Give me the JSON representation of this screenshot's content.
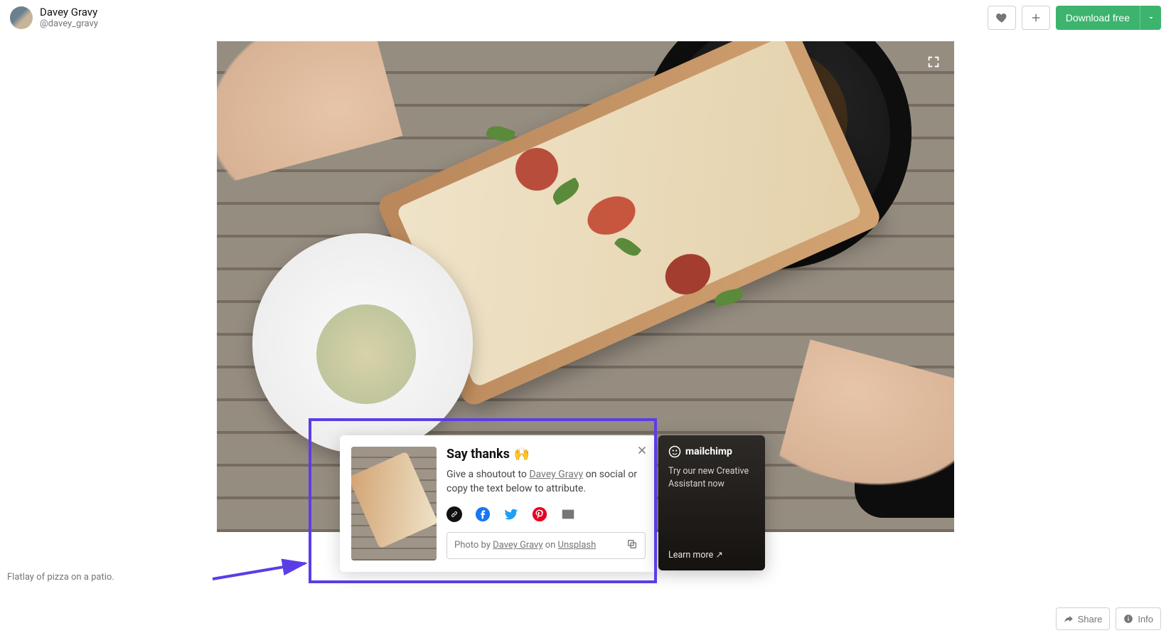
{
  "user": {
    "name": "Davey Gravy",
    "handle": "@davey_gravy"
  },
  "header": {
    "download_label": "Download free"
  },
  "caption": "Flatlay of pizza on a patio.",
  "thanks": {
    "title": "Say thanks",
    "emoji": "🙌",
    "desc_prefix": "Give a shoutout to ",
    "author": "Davey Gravy",
    "desc_suffix": " on social or copy the text below to attribute.",
    "attrib_prefix": "Photo by ",
    "attrib_author": "Davey Gravy",
    "attrib_mid": " on ",
    "attrib_site": "Unsplash"
  },
  "mailchimp": {
    "brand": "mailchimp",
    "text": "Try our new Creative Assistant now",
    "learn": "Learn more ↗"
  },
  "footer": {
    "share": "Share",
    "info": "Info"
  }
}
